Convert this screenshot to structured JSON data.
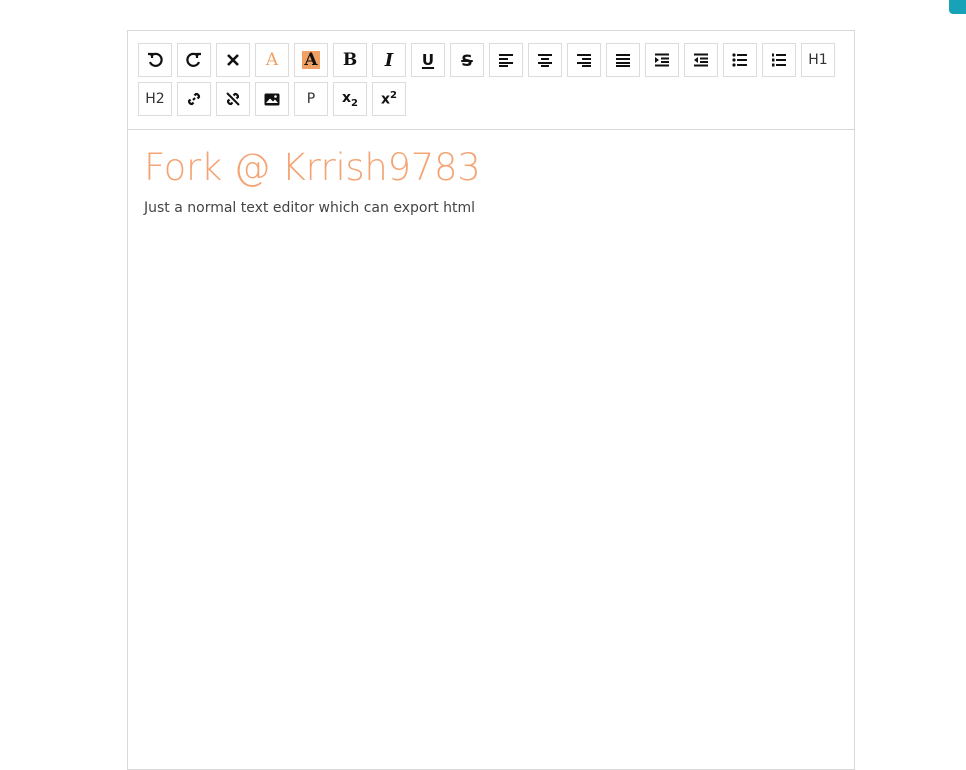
{
  "colors": {
    "accent": "#f4a474",
    "highlight": "#f0a063",
    "corner_tab": "#17a2b8"
  },
  "toolbar": {
    "buttons": [
      {
        "icon": "undo-icon"
      },
      {
        "icon": "redo-icon"
      },
      {
        "icon": "remove-format-icon"
      },
      {
        "icon": "font-color-icon",
        "label": "A"
      },
      {
        "icon": "background-color-icon",
        "label": "A"
      },
      {
        "icon": "bold-icon",
        "label": "B"
      },
      {
        "icon": "italic-icon",
        "label": "I"
      },
      {
        "icon": "underline-icon",
        "label": "U"
      },
      {
        "icon": "strikethrough-icon",
        "label": "S"
      },
      {
        "icon": "align-left-icon"
      },
      {
        "icon": "align-center-icon"
      },
      {
        "icon": "align-right-icon"
      },
      {
        "icon": "align-justify-icon"
      },
      {
        "icon": "indent-icon"
      },
      {
        "icon": "outdent-icon"
      },
      {
        "icon": "unordered-list-icon"
      },
      {
        "icon": "ordered-list-icon"
      },
      {
        "icon": "heading1-text",
        "label": "H1"
      },
      {
        "icon": "heading2-text",
        "label": "H2"
      },
      {
        "icon": "link-icon"
      },
      {
        "icon": "unlink-icon"
      },
      {
        "icon": "image-icon"
      },
      {
        "icon": "paragraph-text",
        "label": "P"
      },
      {
        "icon": "subscript-icon",
        "label": "x",
        "sub": "2"
      },
      {
        "icon": "superscript-icon",
        "label": "x",
        "sup": "2"
      }
    ]
  },
  "document": {
    "heading": "Fork @ Krrish9783",
    "paragraph": "Just a normal text editor which can export html"
  }
}
